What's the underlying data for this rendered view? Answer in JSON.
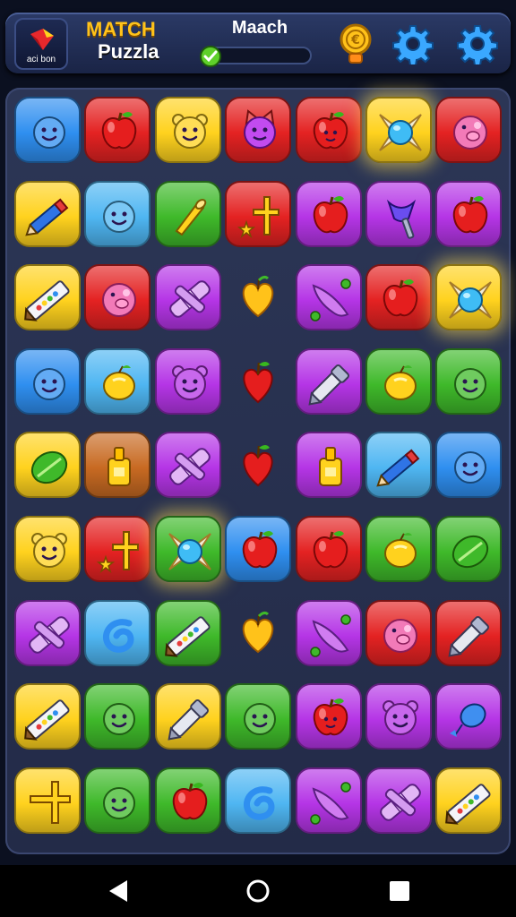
{
  "header": {
    "logo_text": "aci bon",
    "title_line1": "MATCH",
    "title_line2": "Puzzla",
    "progress_label": "Maach",
    "progress_fraction": 0.1
  },
  "icons": {
    "coin": "coin-icon",
    "settings": "gear-icon",
    "nav_back": "back-triangle-icon",
    "nav_home": "home-circle-icon",
    "nav_recent": "recent-square-icon"
  },
  "colors": {
    "blue": "#2f8ff0",
    "red": "#e42222",
    "yellow": "#ffd21e",
    "green": "#3fb92a",
    "purple": "#b535e6",
    "lightblue": "#4fb6f2",
    "orange": "#c86a22"
  },
  "board": {
    "columns": 7,
    "rows": [
      [
        {
          "color": "blue",
          "item": "face"
        },
        {
          "color": "red",
          "item": "apple"
        },
        {
          "color": "yellow",
          "item": "bear"
        },
        {
          "color": "red",
          "item": "cat"
        },
        {
          "color": "red",
          "item": "apple-face"
        },
        {
          "color": "yellow",
          "item": "candy",
          "glow": true
        },
        {
          "color": "red",
          "item": "pig"
        }
      ],
      [
        {
          "color": "yellow",
          "item": "pencil"
        },
        {
          "color": "lightblue",
          "item": "face"
        },
        {
          "color": "green",
          "item": "horn"
        },
        {
          "color": "red",
          "item": "cross-star"
        },
        {
          "color": "purple",
          "item": "apple"
        },
        {
          "color": "purple",
          "item": "plunger"
        },
        {
          "color": "purple",
          "item": "apple"
        }
      ],
      [
        {
          "color": "yellow",
          "item": "crayon"
        },
        {
          "color": "red",
          "item": "pig"
        },
        {
          "color": "purple",
          "item": "bandage"
        },
        {
          "color": "none",
          "item": "heart"
        },
        {
          "color": "purple",
          "item": "pea"
        },
        {
          "color": "red",
          "item": "apple"
        },
        {
          "color": "yellow",
          "item": "candy",
          "glow": true
        }
      ],
      [
        {
          "color": "blue",
          "item": "face"
        },
        {
          "color": "lightblue",
          "item": "lemon"
        },
        {
          "color": "purple",
          "item": "bear"
        },
        {
          "color": "none",
          "item": "strawberry"
        },
        {
          "color": "purple",
          "item": "pen"
        },
        {
          "color": "green",
          "item": "lemon"
        },
        {
          "color": "green",
          "item": "face"
        }
      ],
      [
        {
          "color": "yellow",
          "item": "leaf"
        },
        {
          "color": "orange",
          "item": "glue"
        },
        {
          "color": "purple",
          "item": "bandage"
        },
        {
          "color": "none",
          "item": "strawberry"
        },
        {
          "color": "purple",
          "item": "glue"
        },
        {
          "color": "lightblue",
          "item": "pencil"
        },
        {
          "color": "blue",
          "item": "face"
        }
      ],
      [
        {
          "color": "yellow",
          "item": "bear"
        },
        {
          "color": "red",
          "item": "cross-star"
        },
        {
          "color": "green",
          "item": "candy",
          "glow": true
        },
        {
          "color": "blue",
          "item": "apple"
        },
        {
          "color": "red",
          "item": "apple"
        },
        {
          "color": "green",
          "item": "lemon"
        },
        {
          "color": "green",
          "item": "leaf"
        }
      ],
      [
        {
          "color": "purple",
          "item": "bandage"
        },
        {
          "color": "lightblue",
          "item": "swirl"
        },
        {
          "color": "green",
          "item": "crayon"
        },
        {
          "color": "none",
          "item": "heart"
        },
        {
          "color": "purple",
          "item": "pea"
        },
        {
          "color": "red",
          "item": "pig"
        },
        {
          "color": "red",
          "item": "pen"
        }
      ],
      [
        {
          "color": "yellow",
          "item": "crayon"
        },
        {
          "color": "green",
          "item": "face"
        },
        {
          "color": "yellow",
          "item": "pen"
        },
        {
          "color": "green",
          "item": "face"
        },
        {
          "color": "purple",
          "item": "apple-face"
        },
        {
          "color": "purple",
          "item": "bear"
        },
        {
          "color": "purple",
          "item": "balloon"
        }
      ],
      [
        {
          "color": "yellow",
          "item": "cross"
        },
        {
          "color": "green",
          "item": "face"
        },
        {
          "color": "green",
          "item": "apple"
        },
        {
          "color": "lightblue",
          "item": "swirl"
        },
        {
          "color": "purple",
          "item": "pea"
        },
        {
          "color": "purple",
          "item": "bandage"
        },
        {
          "color": "yellow",
          "item": "crayon"
        }
      ]
    ]
  }
}
